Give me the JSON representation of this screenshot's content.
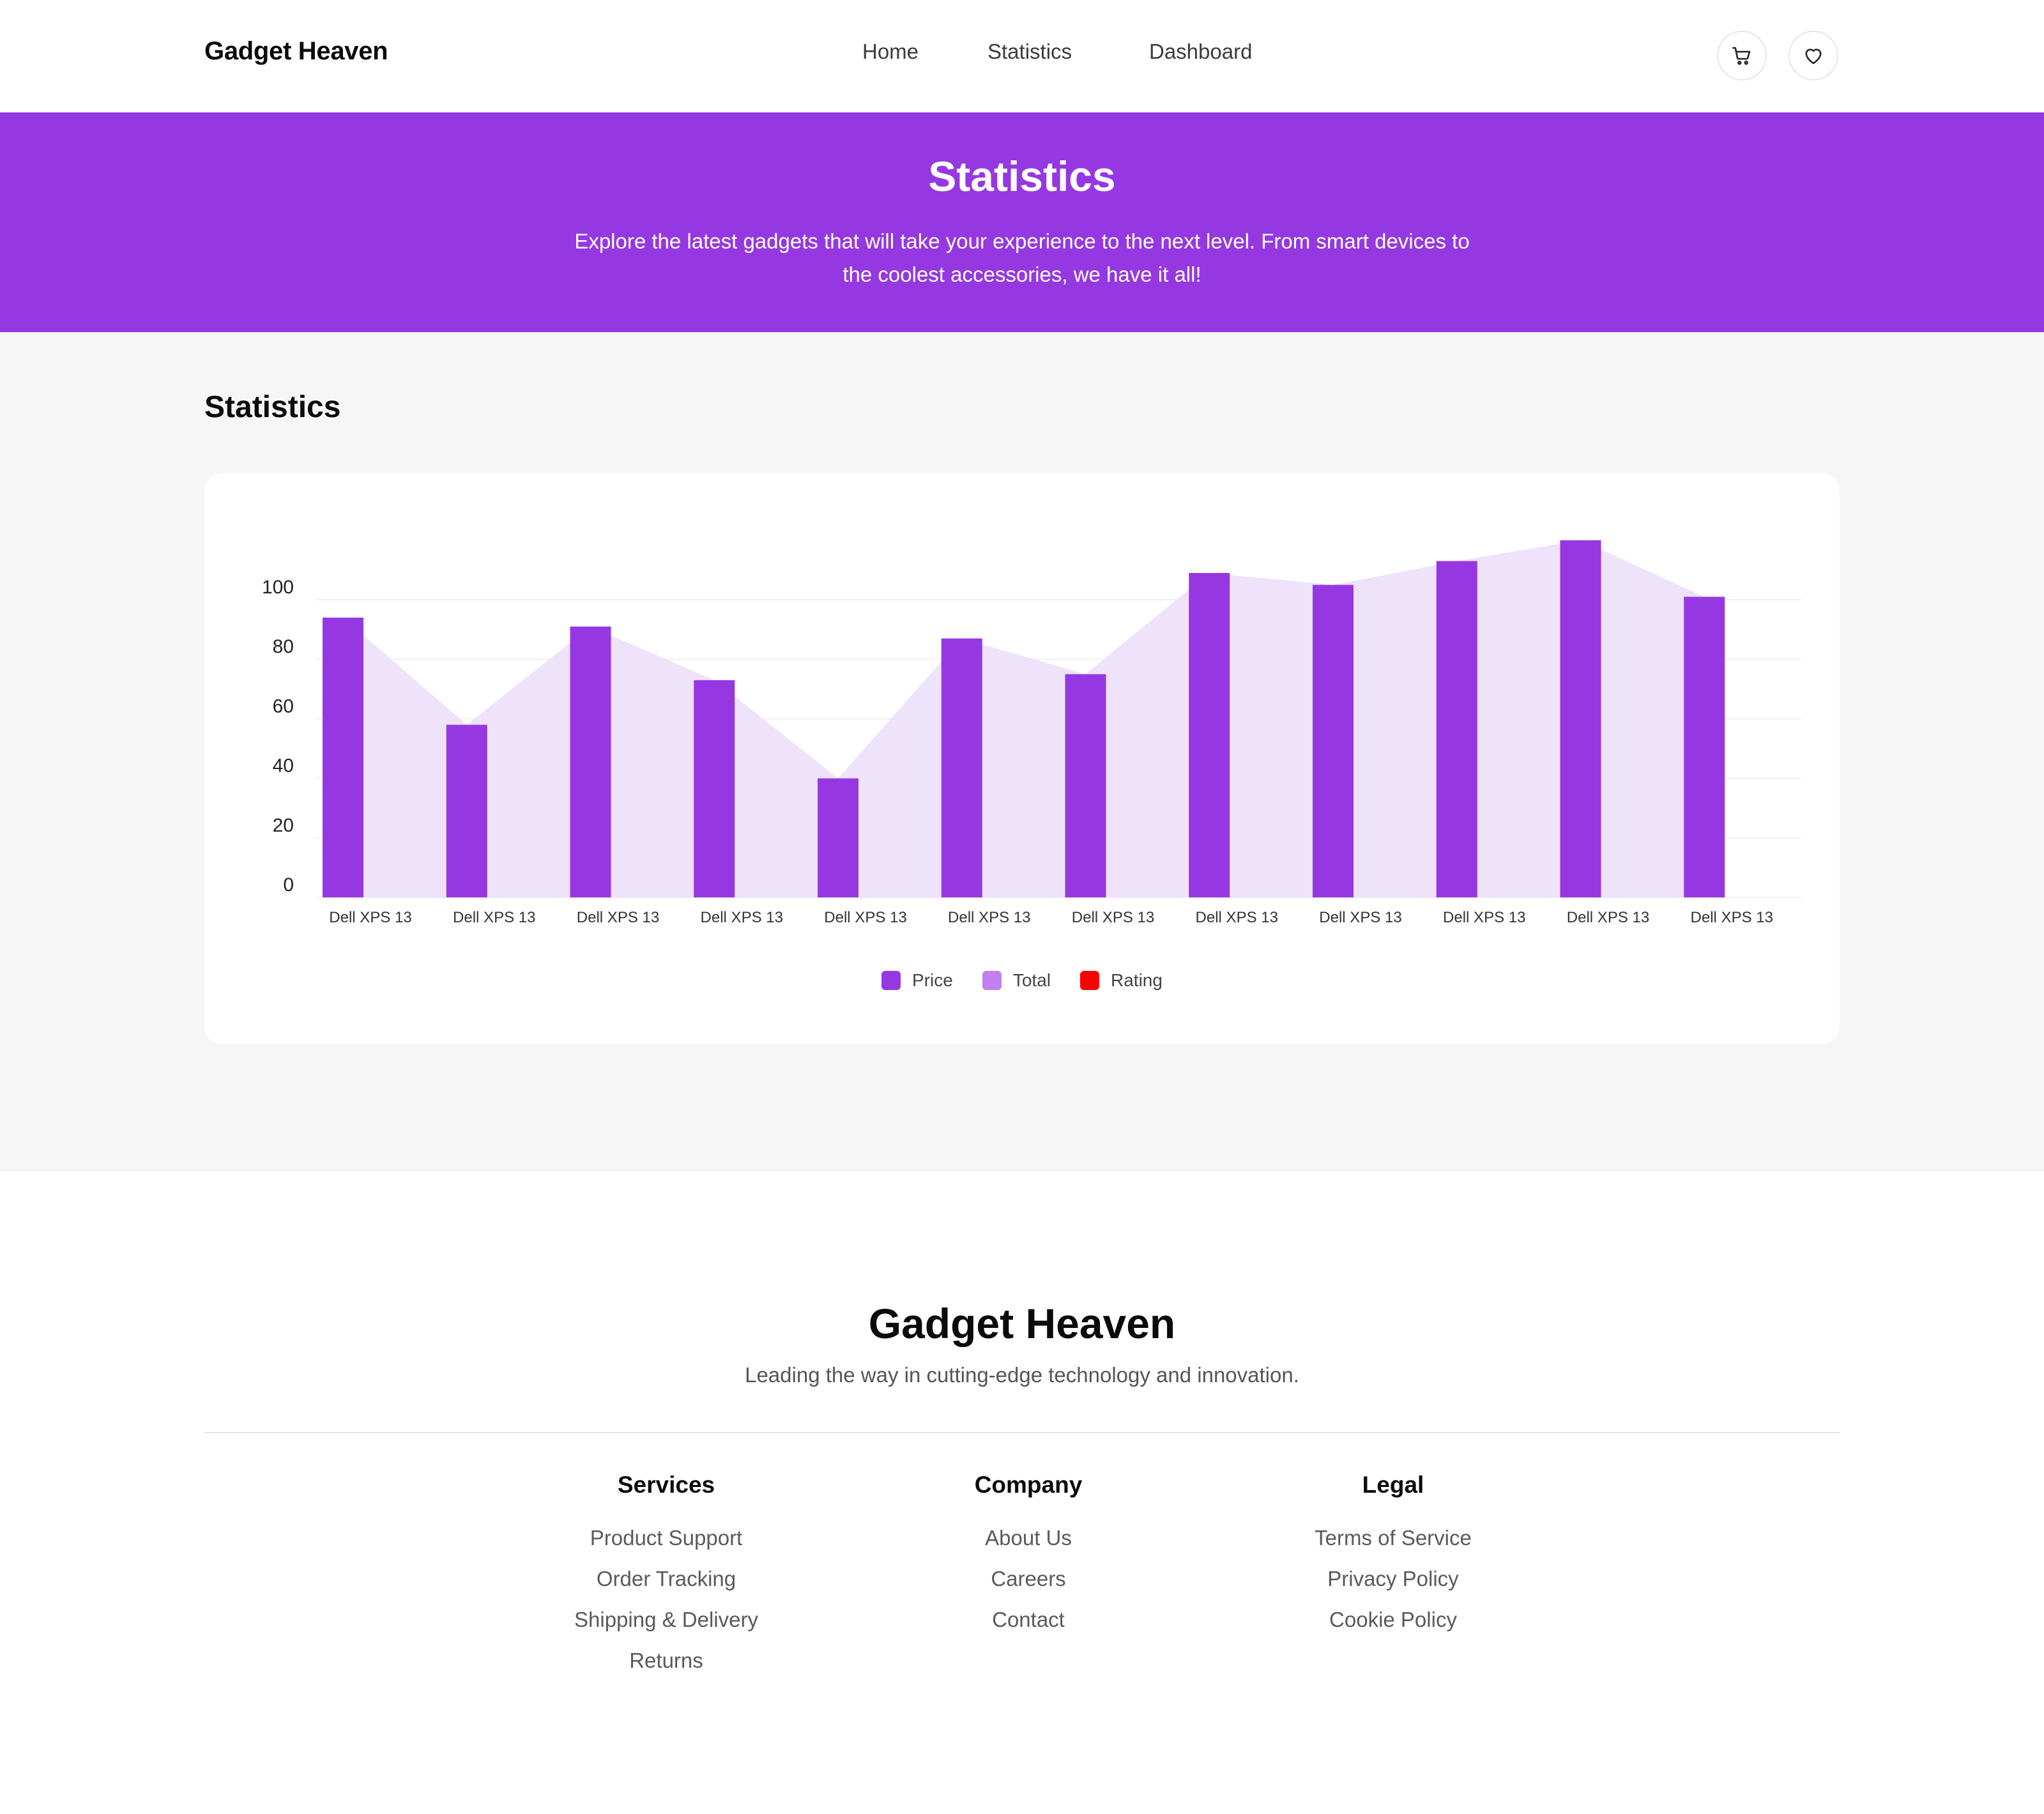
{
  "navbar": {
    "brand": "Gadget Heaven",
    "links": [
      "Home",
      "Statistics",
      "Dashboard"
    ],
    "icons": [
      "cart-icon",
      "heart-icon"
    ]
  },
  "banner": {
    "title": "Statistics",
    "subtitle_line1": "Explore the latest gadgets that will take your experience to the next level. From smart devices to",
    "subtitle_line2": "the coolest accessories, we have it all!"
  },
  "main": {
    "section_title": "Statistics"
  },
  "colors": {
    "accent": "#9538e2",
    "area": "#efe2fb",
    "total": "#c27ff0",
    "rating": "#ff0000"
  },
  "chart_data": {
    "type": "bar",
    "categories": [
      "Dell XPS 13",
      "Dell XPS 13",
      "Dell XPS 13",
      "Dell XPS 13",
      "Dell XPS 13",
      "Dell XPS 13",
      "Dell XPS 13",
      "Dell XPS 13",
      "Dell XPS 13",
      "Dell XPS 13",
      "Dell XPS 13",
      "Dell XPS 13"
    ],
    "series": [
      {
        "name": "Price",
        "type": "bar",
        "color": "#9538e2",
        "values": [
          94,
          58,
          91,
          73,
          40,
          87,
          75,
          109,
          105,
          113,
          120,
          101
        ]
      },
      {
        "name": "Total",
        "type": "area",
        "color": "#c27ff0",
        "values": [
          94,
          58,
          91,
          73,
          40,
          87,
          75,
          109,
          105,
          113,
          120,
          101
        ]
      },
      {
        "name": "Rating",
        "type": "scatter",
        "color": "#ff0000",
        "values": []
      }
    ],
    "yticks": [
      0,
      20,
      40,
      60,
      80,
      100
    ],
    "ylim": [
      0,
      120
    ],
    "grid": true,
    "legend": "bottom-center",
    "title": "",
    "xlabel": "",
    "ylabel": ""
  },
  "footer": {
    "brand": "Gadget Heaven",
    "tagline": "Leading the way in cutting-edge technology and innovation.",
    "columns": [
      {
        "title": "Services",
        "links": [
          "Product Support",
          "Order Tracking",
          "Shipping & Delivery",
          "Returns"
        ]
      },
      {
        "title": "Company",
        "links": [
          "About Us",
          "Careers",
          "Contact"
        ]
      },
      {
        "title": "Legal",
        "links": [
          "Terms of Service",
          "Privacy Policy",
          "Cookie Policy"
        ]
      }
    ]
  }
}
